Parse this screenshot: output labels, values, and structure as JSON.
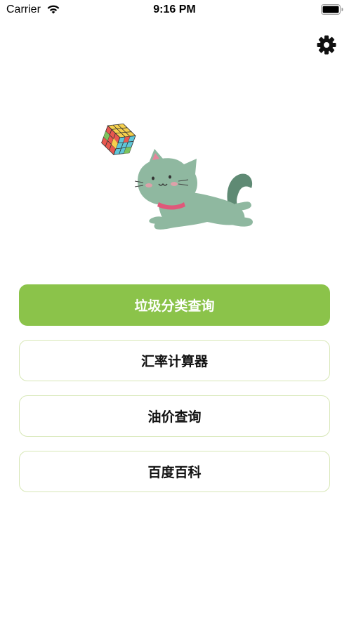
{
  "status_bar": {
    "carrier": "Carrier",
    "time": "9:16 PM",
    "wifi_icon": "wifi-icon",
    "battery_icon": "battery-icon"
  },
  "header": {
    "settings_icon": "gear-icon"
  },
  "hero": {
    "image": "cat-chasing-rubiks-cube"
  },
  "menu": {
    "items": [
      {
        "label": "垃圾分类查询",
        "primary": true
      },
      {
        "label": "汇率计算器",
        "primary": false
      },
      {
        "label": "油价查询",
        "primary": false
      },
      {
        "label": "百度百科",
        "primary": false
      }
    ]
  },
  "colors": {
    "accent": "#8bc34a",
    "button_border": "#d7e7b6",
    "cat_body": "#8fb8a0",
    "cat_tail": "#5f8a74"
  }
}
